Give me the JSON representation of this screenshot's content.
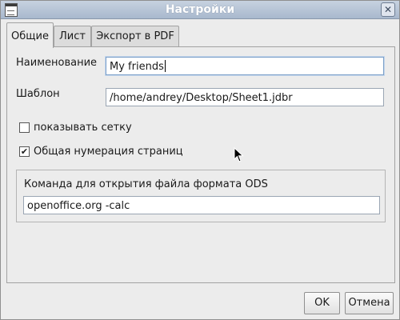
{
  "window": {
    "title": "Настройки"
  },
  "tabs": [
    {
      "label": "Общие",
      "active": true
    },
    {
      "label": "Лист",
      "active": false
    },
    {
      "label": "Экспорт в PDF",
      "active": false
    }
  ],
  "general": {
    "name_label": "Наименование",
    "name_value": "My friends",
    "template_label": "Шаблон",
    "template_value": "/home/andrey/Desktop/Sheet1.jdbr",
    "show_grid_label": "показывать сетку",
    "show_grid_checked": false,
    "page_numbering_label": "Общая нумерация страниц",
    "page_numbering_checked": true,
    "ods_group_label": "Команда для открытия файла формата ODS",
    "ods_command_value": "openoffice.org -calc"
  },
  "buttons": {
    "ok": "OK",
    "cancel": "Отмена"
  },
  "icons": {
    "app": "app-document-icon",
    "close": "close-icon",
    "check": "✔",
    "close_glyph": "✕"
  }
}
